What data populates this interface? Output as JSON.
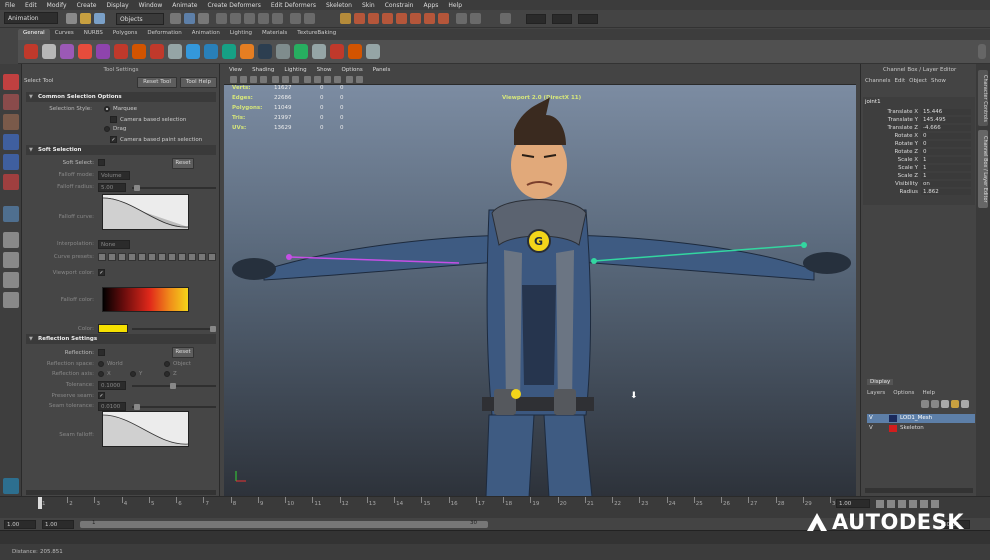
{
  "menubar": [
    "File",
    "Edit",
    "Modify",
    "Create",
    "Display",
    "Window",
    "Animate",
    "Create Deformers",
    "Edit Deformers",
    "Skeleton",
    "Skin",
    "Constrain",
    "Apps",
    "Help"
  ],
  "statusline": {
    "mode": "Animation",
    "selection_mode": "Objects"
  },
  "shelf": {
    "tabs": [
      "General",
      "Curves",
      "NURBS",
      "Polygons",
      "Deformation",
      "Animation",
      "Lighting",
      "Materials",
      "TextureBaking"
    ],
    "active": "General"
  },
  "tool_settings": {
    "header": "Tool Settings",
    "tool_name": "Select Tool",
    "reset_label": "Reset Tool",
    "help_label": "Tool Help",
    "common": {
      "title": "Common Selection Options",
      "style_label": "Selection Style:",
      "marquee": "Marquee",
      "camera_based": "Camera based selection",
      "drag": "Drag",
      "camera_paint": "Camera based paint selection"
    },
    "soft": {
      "title": "Soft Selection",
      "soft_select_label": "Soft Select:",
      "reset": "Reset",
      "falloff_mode_label": "Falloff mode:",
      "falloff_mode_value": "Volume",
      "falloff_radius_label": "Falloff radius:",
      "falloff_radius_value": "5.00",
      "falloff_curve_label": "Falloff curve:",
      "interpolation_label": "Interpolation:",
      "interpolation_value": "None",
      "curve_presets_label": "Curve presets:",
      "viewport_color_label": "Viewport color:",
      "falloff_color_label": "Falloff color:",
      "color_label": "Color:"
    },
    "reflection": {
      "title": "Reflection Settings",
      "reflection_label": "Reflection:",
      "reset": "Reset",
      "space_label": "Reflection space:",
      "space_world": "World",
      "space_object": "Object",
      "axis_label": "Reflection axis:",
      "axis_x": "X",
      "axis_y": "Y",
      "axis_z": "Z",
      "tolerance_label": "Tolerance:",
      "tolerance_value": "0.1000",
      "preserve_label": "Preserve seam:",
      "seam_tol_label": "Seam tolerance:",
      "seam_tol_value": "0.0100",
      "seam_falloff_label": "Seam falloff:"
    }
  },
  "viewport": {
    "menu": [
      "View",
      "Shading",
      "Lighting",
      "Show",
      "Options",
      "Panels"
    ],
    "hud": [
      {
        "label": "Verts:",
        "v1": "11627",
        "v2": "0",
        "v3": "0"
      },
      {
        "label": "Edges:",
        "v1": "22686",
        "v2": "0",
        "v3": "0"
      },
      {
        "label": "Polygons:",
        "v1": "11049",
        "v2": "0",
        "v3": "0"
      },
      {
        "label": "Tris:",
        "v1": "21997",
        "v2": "0",
        "v3": "0"
      },
      {
        "label": "UVs:",
        "v1": "13629",
        "v2": "0",
        "v3": "0"
      }
    ],
    "renderer": "Viewport 2.0 (DirectX 11)"
  },
  "channel_box": {
    "title": "Channel Box / Layer Editor",
    "menu": [
      "Channels",
      "Edit",
      "Object",
      "Show"
    ],
    "object": "joint1",
    "channels": [
      {
        "name": "Translate X",
        "value": "15.446"
      },
      {
        "name": "Translate Y",
        "value": "145.495"
      },
      {
        "name": "Translate Z",
        "value": "-4.666"
      },
      {
        "name": "Rotate X",
        "value": "0"
      },
      {
        "name": "Rotate Y",
        "value": "0"
      },
      {
        "name": "Rotate Z",
        "value": "0"
      },
      {
        "name": "Scale X",
        "value": "1"
      },
      {
        "name": "Scale Y",
        "value": "1"
      },
      {
        "name": "Scale Z",
        "value": "1"
      },
      {
        "name": "Visibility",
        "value": "on"
      },
      {
        "name": "Radius",
        "value": "1.862"
      }
    ]
  },
  "side_tabs": [
    "Character Controls",
    "Channel Box / Layer Editor"
  ],
  "layer_editor": {
    "tab": "Display",
    "menu": [
      "Layers",
      "Options",
      "Help"
    ],
    "layers": [
      {
        "v": "V",
        "name": "LOD1_Mesh",
        "color": "#1a2a5c",
        "selected": true
      },
      {
        "v": "V",
        "name": "Skeleton",
        "color": "#d11d1d",
        "selected": false
      }
    ]
  },
  "timeline": {
    "ticks": [
      "1",
      "2",
      "3",
      "4",
      "5",
      "6",
      "7",
      "8",
      "9",
      "10",
      "11",
      "12",
      "13",
      "14",
      "15",
      "16",
      "17",
      "18",
      "19",
      "20",
      "21",
      "22",
      "23",
      "24",
      "25",
      "26",
      "27",
      "28",
      "29",
      "30"
    ],
    "current_frame": "1.00"
  },
  "range": {
    "start": "1.00",
    "inner_start": "1.00",
    "range_start": "1",
    "range_end": "30",
    "end": "30.00"
  },
  "helpline": {
    "distance_label": "Distance:",
    "distance_value": "205.851"
  },
  "watermark": "AUTODESK",
  "colors": {
    "accent_select": "#5d7fa8",
    "hud_label": "#d7e77a",
    "bone_left": "#c64fe6",
    "bone_right": "#33d6a0"
  }
}
